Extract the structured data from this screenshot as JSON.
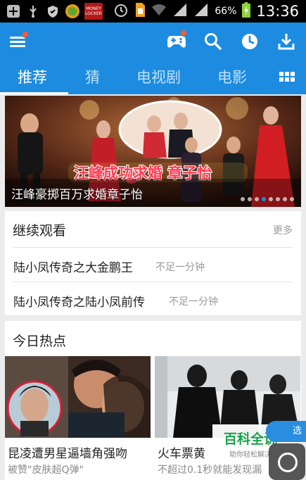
{
  "status_bar": {
    "battery_percent": "66%",
    "time": "13:36",
    "money_locker_label": "MONEY LOCKER"
  },
  "app_bar": {
    "icons": [
      "menu-icon",
      "gamepad-icon",
      "search-icon",
      "history-clock-icon",
      "download-icon"
    ]
  },
  "tabs": {
    "items": [
      "推荐",
      "猜",
      "电视剧",
      "电影"
    ],
    "active_index": 0
  },
  "banner": {
    "caption": "汪峰豪掷百万求婚章子怡",
    "overlay_text": "汪峰成功求婚 章子怡",
    "page_count": 8,
    "active_dot": 3
  },
  "continue_watching": {
    "title": "继续观看",
    "more": "更多",
    "items": [
      {
        "title": "陆小凤传奇之大金鹏王",
        "progress": "不足一分钟"
      },
      {
        "title": "陆小凤传奇之陆小凤前传",
        "progress": "不足一分钟"
      }
    ]
  },
  "hot_today": {
    "title": "今日热点",
    "items": [
      {
        "title": "昆凌遭男星逼墙角强吻",
        "subtitle": "被赞\"皮肤超Q弹\""
      },
      {
        "title": "火车票黄",
        "subtitle": "不超过0.1秒就能发现漏"
      }
    ]
  },
  "watermark": {
    "main": "百科全说",
    "sub": "助你轻松解决"
  },
  "float_tag": "选"
}
